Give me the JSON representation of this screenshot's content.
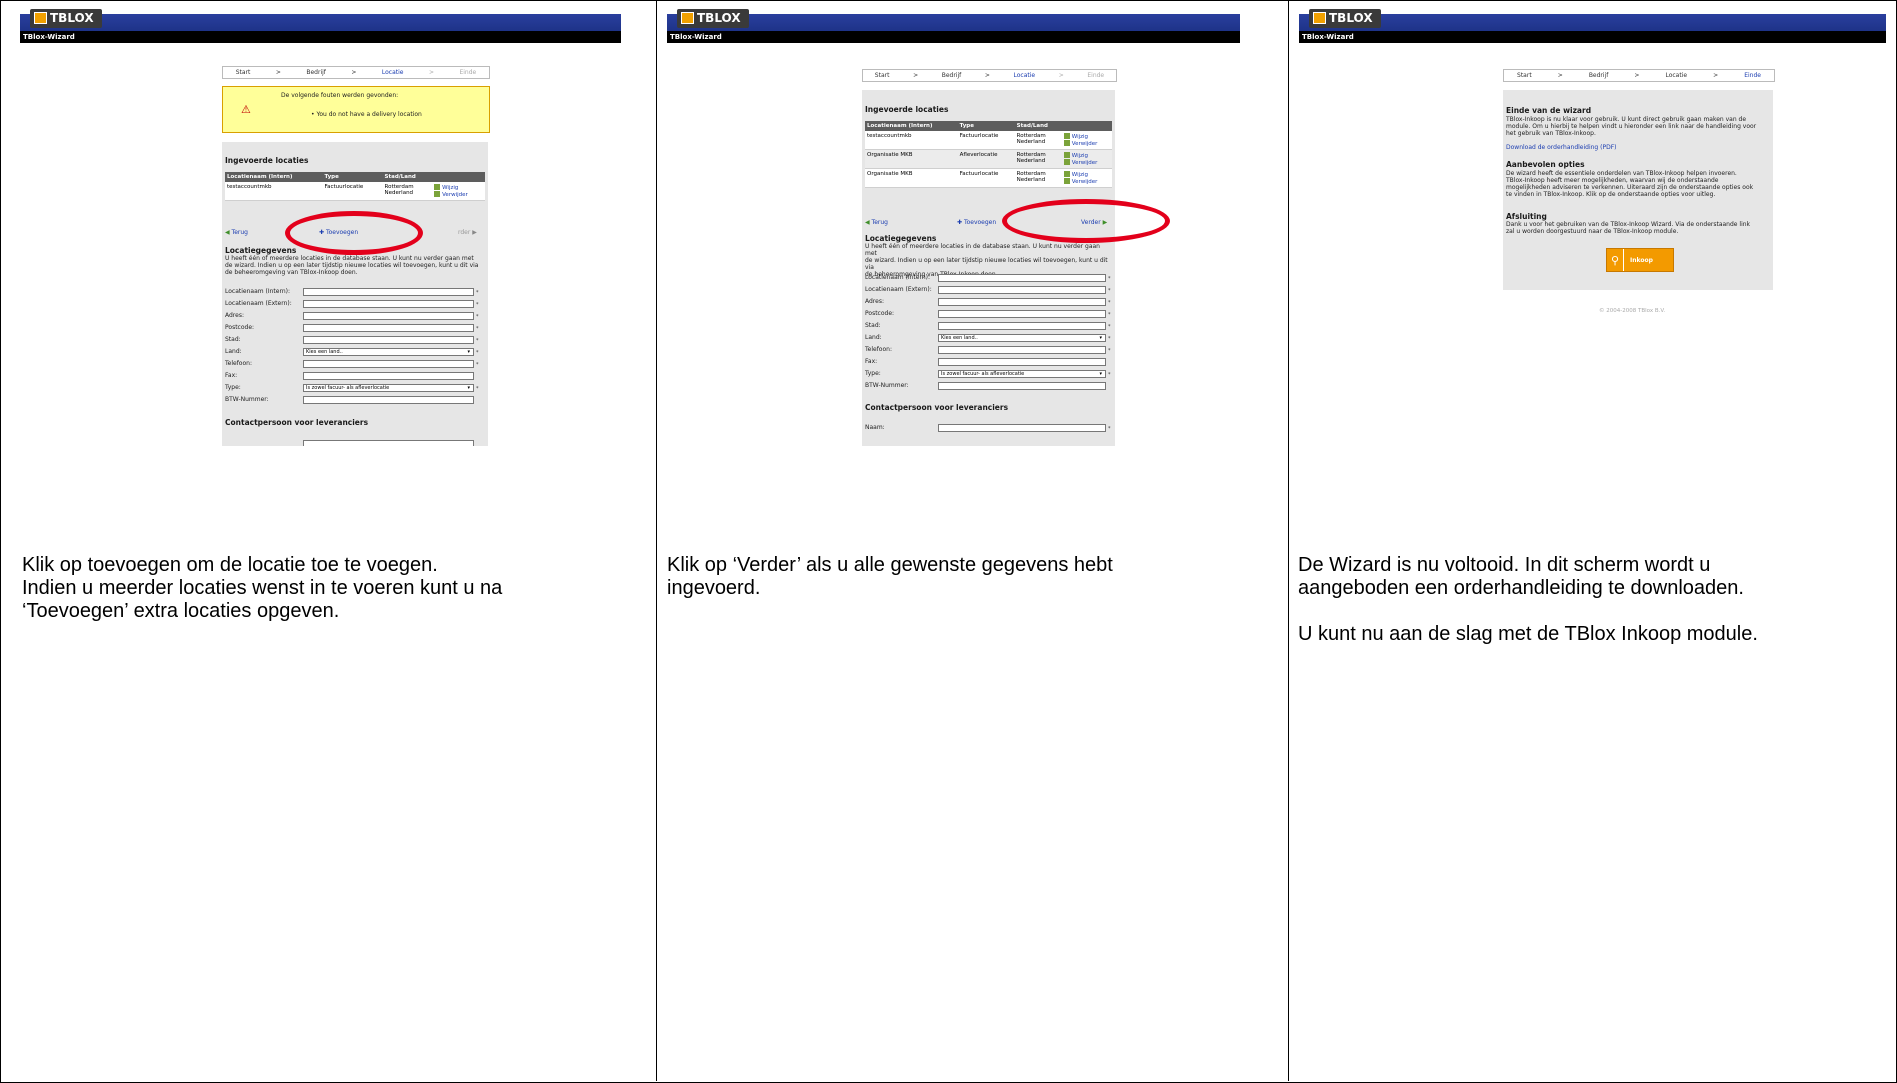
{
  "app": {
    "logo_text": "TBLOX",
    "wizard_title": "TBlox-Wizard"
  },
  "steps": [
    {
      "label": "Start"
    },
    {
      "label": ">"
    },
    {
      "label": "Bedrijf"
    },
    {
      "label": ">"
    },
    {
      "label": "Locatie"
    },
    {
      "label": ">"
    },
    {
      "label": "Einde"
    }
  ],
  "errors": {
    "heading": "De volgende fouten werden gevonden:",
    "item": "You do not have a delivery location"
  },
  "locations": {
    "heading": "Ingevoerde locaties",
    "columns": [
      "Locatienaam (Intern)",
      "Type",
      "Stad/Land"
    ],
    "row1": {
      "name": "testaccountmkb",
      "type": "Factuurlocatie",
      "city": "Rotterdam",
      "country": "Nederland"
    },
    "row2": {
      "name": "Organisatie MKB",
      "type": "Afleverlocatie",
      "city": "Rotterdam",
      "country": "Nederland"
    },
    "row3": {
      "name": "Organisatie MKB",
      "type": "Factuurlocatie",
      "city": "Rotterdam",
      "country": "Nederland"
    },
    "edit": "Wijzig",
    "delete": "Verwijder"
  },
  "nav": {
    "back": "Terug",
    "add": "Toevoegen",
    "next": "Verder",
    "next_partial": "rder"
  },
  "details": {
    "heading": "Locatiegegevens",
    "intro": "U heeft één of meerdere locaties in de database staan. U kunt nu verder gaan met de wizard. Indien u op een later tijdstip nieuwe locaties wil toevoegen, kunt u dit via de beheeromgeving van TBlox-Inkoop doen.",
    "intro_l1": "U heeft één of meerdere locaties in de database staan. U kunt nu verder gaan met",
    "intro_l2": "de wizard. Indien u op een later tijdstip nieuwe locaties wil toevoegen, kunt u dit via",
    "intro_l3": "de beheeromgeving van TBlox-Inkoop doen."
  },
  "form": {
    "name_intern": "Locatienaam (Intern):",
    "name_extern": "Locatienaam (Extern):",
    "address": "Adres:",
    "postcode": "Postcode:",
    "city": "Stad:",
    "country": "Land:",
    "country_value": "Kies een land..",
    "phone": "Telefoon:",
    "fax": "Fax:",
    "type": "Type:",
    "type_value": "Is zowel facuur- als afleverlocatie",
    "vat": "BTW-Nummer:",
    "star": "*"
  },
  "contact": {
    "heading": "Contactpersoon voor leveranciers",
    "name": "Naam:"
  },
  "end": {
    "heading": "Einde van de wizard",
    "l1": "TBlox-Inkoop is nu klaar voor gebruik. U kunt direct gebruik gaan maken van de",
    "l2": "module. Om u hierbij te helpen vindt u hieronder een link naar de handleiding voor",
    "l3": "het gebruik van TBlox-Inkoop.",
    "download": "Download de orderhandleiding (PDF)",
    "rec_heading": "Aanbevolen opties",
    "r1": "De wizard heeft de essentiele onderdelen van TBlox-Inkoop helpen invoeren.",
    "r2": "TBlox-Inkoop heeft meer mogelijkheden, waarvan wij de onderstaande",
    "r3": "mogelijkheden adviseren te verkennen. Uiteraard zijn de onderstaande opties ook",
    "r4": "te vinden in TBlox-Inkoop. Klik op de onderstaande opties voor uitleg.",
    "close_heading": "Afsluiting",
    "c1": "Dank u voor het gebruiken van de TBlox-Inkoop Wizard. Via de onderstaande link",
    "c2": "zal u worden doorgestuurd naar de TBlox-Inkoop module.",
    "button": "Inkoop",
    "copyright": "© 2004-2008 TBlox B.V."
  },
  "captions": {
    "c1_l1": "Klik op toevoegen om de locatie toe te voegen.",
    "c1_l2": "Indien u meerder locaties wenst in te voeren kunt u na",
    "c1_l3": "‘Toevoegen’ extra locaties opgeven.",
    "c2_l1": "Klik op ‘Verder’ als u alle gewenste gegevens hebt",
    "c2_l2": "ingevoerd.",
    "c3_l1": "De Wizard is nu voltooid. In dit scherm wordt u",
    "c3_l2": "aangeboden een orderhandleiding te downloaden.",
    "c3_l3": "U kunt nu aan de slag met de TBlox Inkoop module."
  },
  "colors": {
    "header_blue": "#1e3388",
    "panel_gray": "#e6e6e6",
    "annotation_red": "#e3001b",
    "button_orange": "#f39a00"
  }
}
